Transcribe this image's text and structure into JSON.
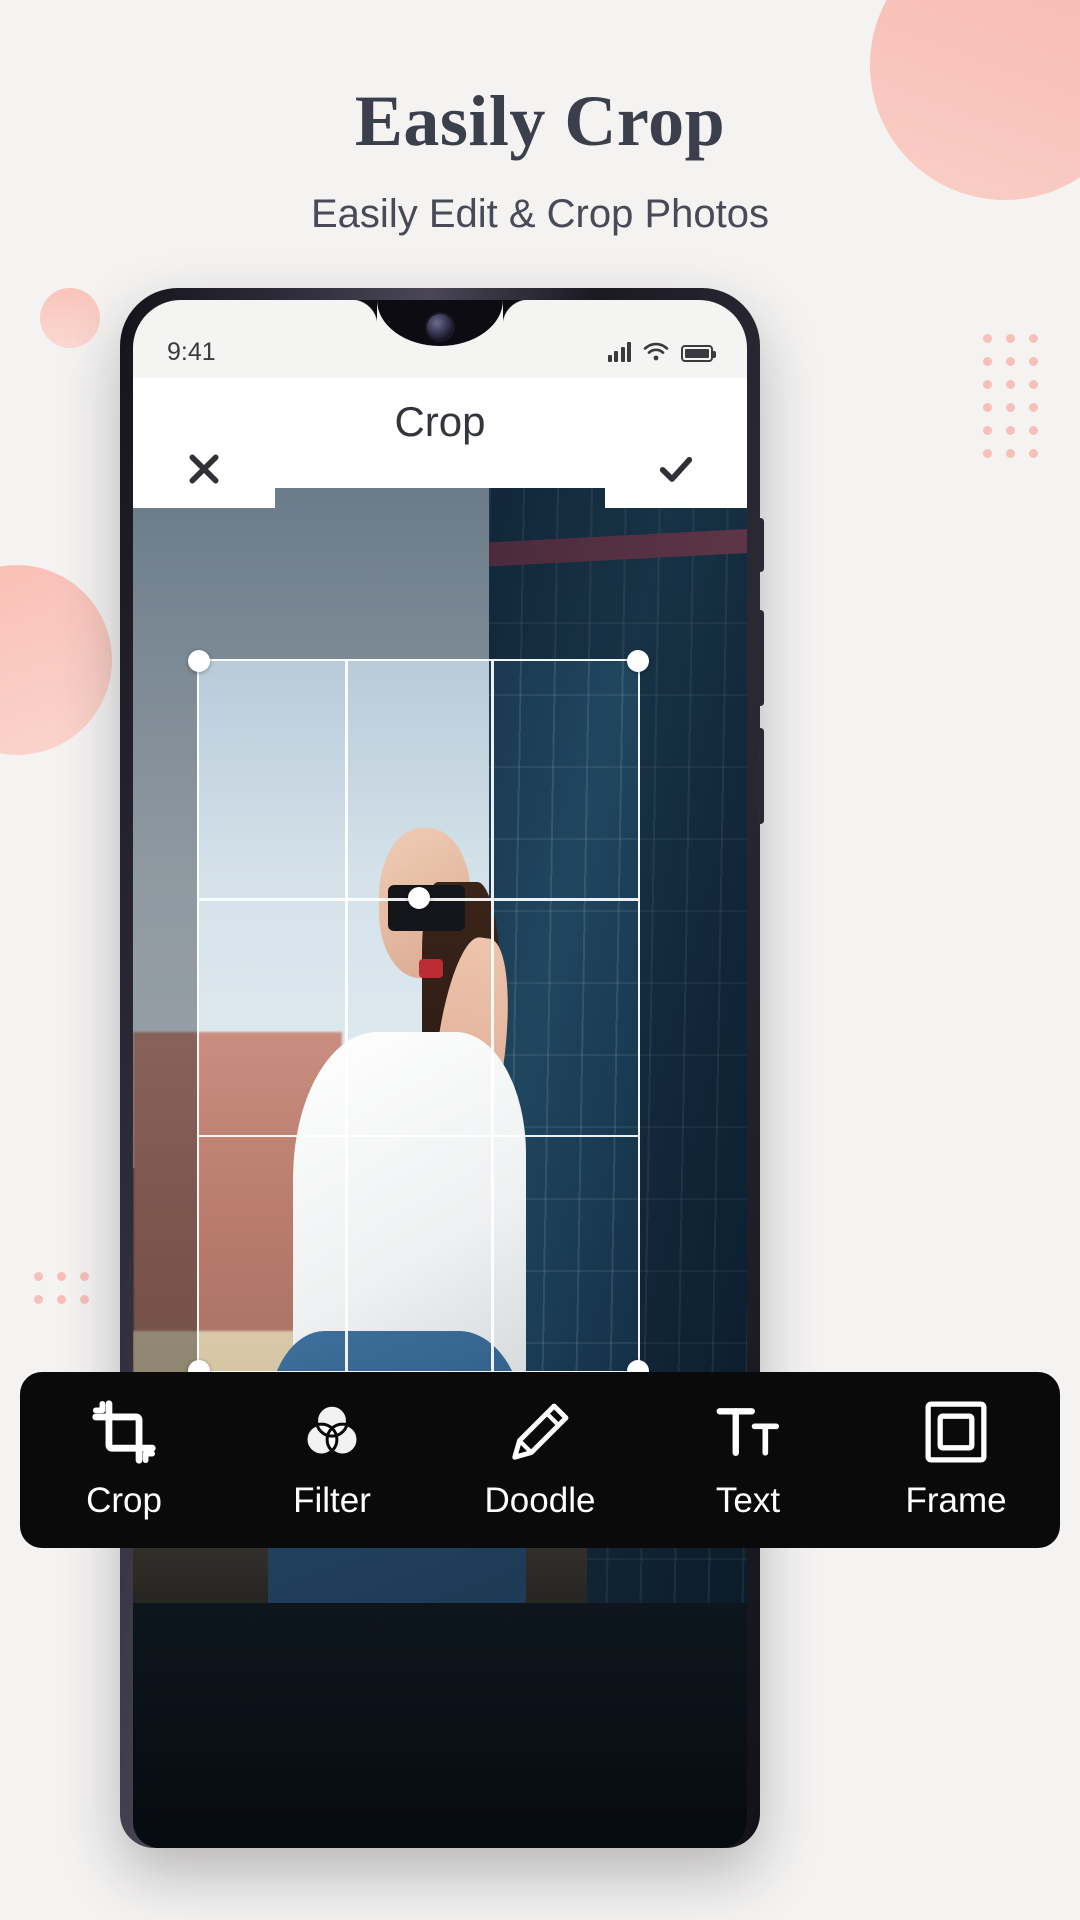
{
  "page": {
    "headline": "Easily Crop",
    "subhead": "Easily Edit & Crop Photos",
    "background_color": "#f4f3f2",
    "headline_color": "#3a3f4b",
    "accent_color": "#f8b6b0"
  },
  "phone": {
    "status_bar": {
      "time": "9:41",
      "signal_icon": "cellular-signal-icon",
      "wifi_icon": "wifi-icon",
      "battery_icon": "battery-full-icon"
    },
    "app_bar": {
      "title": "Crop",
      "close_icon": "close-x-icon",
      "done_icon": "checkmark-icon"
    },
    "crop_overlay": {
      "grid": "rule-of-thirds",
      "handles": [
        "top-left",
        "top-right",
        "bottom-left",
        "bottom-right",
        "center-top"
      ]
    }
  },
  "toolbar": {
    "background_color": "#0a0a0a",
    "items": [
      {
        "label": "Crop",
        "icon": "crop-icon",
        "active": true
      },
      {
        "label": "Filter",
        "icon": "filter-circles-icon",
        "active": false
      },
      {
        "label": "Doodle",
        "icon": "pencil-icon",
        "active": false
      },
      {
        "label": "Text",
        "icon": "text-tt-icon",
        "active": false
      },
      {
        "label": "Frame",
        "icon": "frame-icon",
        "active": false
      }
    ]
  }
}
